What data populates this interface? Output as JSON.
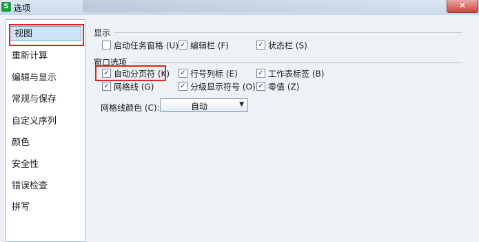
{
  "window": {
    "title": "选项",
    "app_icon": "S",
    "close_glyph": "✕"
  },
  "nav": {
    "items": [
      {
        "label": "视图",
        "selected": true
      },
      {
        "label": "重新计算"
      },
      {
        "label": "编辑与显示"
      },
      {
        "label": "常规与保存"
      },
      {
        "label": "自定义序列"
      },
      {
        "label": "颜色"
      },
      {
        "label": "安全性"
      },
      {
        "label": "错误检查"
      },
      {
        "label": "拼写"
      }
    ]
  },
  "display_group": {
    "title": "显示",
    "options": [
      {
        "label": "启动任务窗格 (U)",
        "checked": false
      },
      {
        "label": "编辑栏 (F)",
        "checked": true
      },
      {
        "label": "状态栏 (S)",
        "checked": true
      }
    ]
  },
  "window_group": {
    "title": "窗口选项",
    "options": [
      {
        "label": "自动分页符 (K)",
        "checked": true
      },
      {
        "label": "行号列标 (E)",
        "checked": true
      },
      {
        "label": "工作表标签 (B)",
        "checked": true
      },
      {
        "label": "网格线 (G)",
        "checked": true
      },
      {
        "label": "分级显示符号 (O)",
        "checked": true
      },
      {
        "label": "零值 (Z)",
        "checked": true
      }
    ]
  },
  "gridline_color": {
    "label": "网格线颜色 (C):",
    "value": "自动",
    "arrow_icon": "▼"
  },
  "colors": {
    "highlight": "#e0211c",
    "selected_bg": "#cfe3f8"
  }
}
